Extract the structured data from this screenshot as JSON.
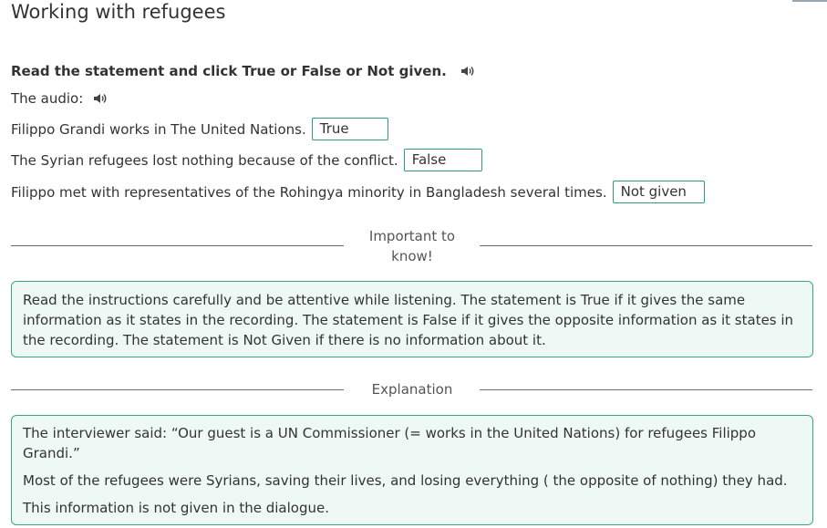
{
  "page": {
    "title": "Working with refugees"
  },
  "task": {
    "instruction": "Read the statement and click True or False or Not given.",
    "audio_label": "The audio:"
  },
  "statements": [
    {
      "text": "Filippo Grandi works in The United Nations.",
      "answer": "True"
    },
    {
      "text": "The Syrian refugees lost nothing because of the conflict.",
      "answer": "False"
    },
    {
      "text": "Filippo met with representatives of the Rohingya minority in Bangladesh several times.",
      "answer": "Not given"
    }
  ],
  "important": {
    "heading_line1": "Important to",
    "heading_line2": "know!",
    "text": "Read the instructions carefully and be attentive while listening. The statement is True if it gives the same information as it states in the recording. The statement is False if it gives the opposite information as it states in the recording. The statement is Not Given if there is no information about it."
  },
  "explanation": {
    "heading": "Explanation",
    "lines": [
      "The interviewer said: “Our guest is a UN Commissioner (= works in the United Nations) for refugees Filippo Grandi.”",
      "Most of the refugees were Syrians, saving their lives, and losing everything ( the opposite of nothing) they had.",
      "This information is not given in the dialogue."
    ]
  },
  "colors": {
    "accent": "#2e9a80",
    "box_background": "#eef8f4",
    "text": "#333333"
  },
  "icons": {
    "speaker": "speaker-icon"
  }
}
